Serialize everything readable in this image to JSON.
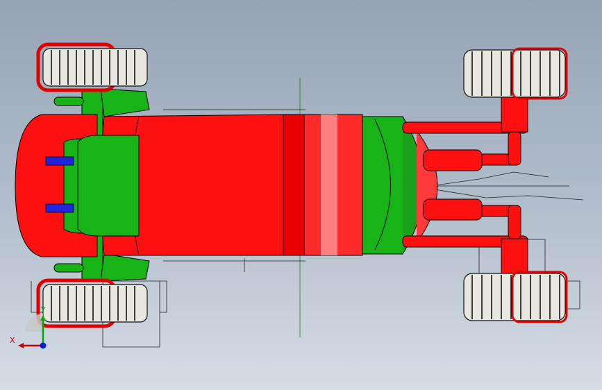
{
  "viewport": {
    "view_mode": "top view",
    "model": {
      "body_color": "#ff0000",
      "frame_color": "#17b317",
      "tire_color": "#e8e8e0",
      "accent_color": "#2222dd",
      "edge_color": "#000000"
    }
  },
  "triad": {
    "x_label": "X",
    "y_label": "Y",
    "x_color": "#cc0000",
    "y_color": "#00aa00",
    "z_color": "#0022cc"
  }
}
